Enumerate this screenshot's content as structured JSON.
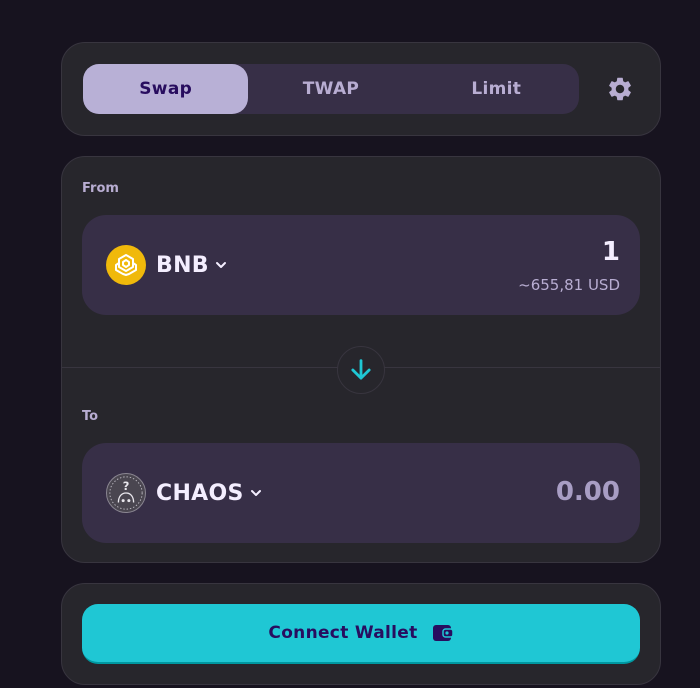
{
  "tabs": [
    {
      "label": "Swap",
      "active": true
    },
    {
      "label": "TWAP",
      "active": false
    },
    {
      "label": "Limit",
      "active": false
    }
  ],
  "settings": {
    "icon": "gear-icon"
  },
  "from": {
    "label": "From",
    "token": "BNB",
    "amount": "1",
    "usd_value": "~655,81 USD",
    "logo_color": "#f0b90b"
  },
  "switch": {
    "icon": "arrow-down-icon",
    "color": "#1fc7d4"
  },
  "to": {
    "label": "To",
    "token": "CHAOS",
    "amount": "0.00"
  },
  "connect": {
    "label": "Connect Wallet",
    "icon": "wallet-icon"
  },
  "colors": {
    "background": "#17131f",
    "card": "#27262c",
    "input": "#372f47",
    "accent": "#1fc7d4",
    "active_tab": "#b8b0d6",
    "text_primary": "#f4eeff",
    "text_secondary": "#b8add2"
  }
}
